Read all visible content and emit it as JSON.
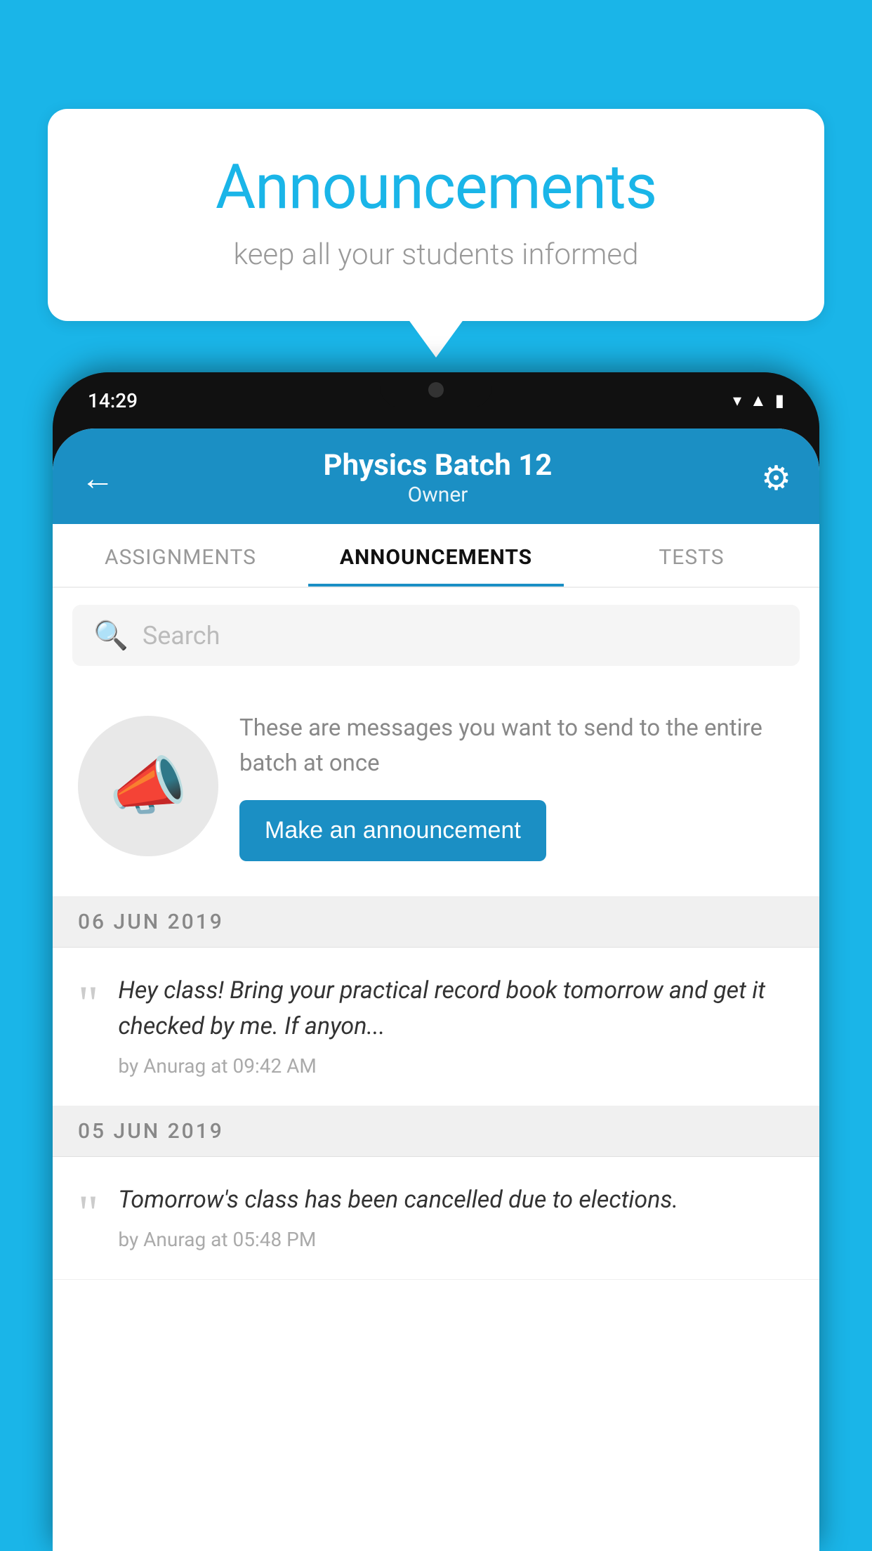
{
  "background_color": "#1ab5e8",
  "speech_bubble": {
    "title": "Announcements",
    "subtitle": "keep all your students informed"
  },
  "phone": {
    "status_bar": {
      "time": "14:29"
    },
    "header": {
      "title": "Physics Batch 12",
      "subtitle": "Owner",
      "back_label": "←",
      "settings_label": "⚙"
    },
    "tabs": [
      {
        "label": "ASSIGNMENTS",
        "active": false
      },
      {
        "label": "ANNOUNCEMENTS",
        "active": true
      },
      {
        "label": "TESTS",
        "active": false
      },
      {
        "label": "...",
        "active": false
      }
    ],
    "search": {
      "placeholder": "Search"
    },
    "promo": {
      "description": "These are messages you want to send to the entire batch at once",
      "button_label": "Make an announcement"
    },
    "announcements": [
      {
        "date": "06  JUN  2019",
        "body": "Hey class! Bring your practical record book tomorrow and get it checked by me. If anyon...",
        "meta": "by Anurag at 09:42 AM"
      },
      {
        "date": "05  JUN  2019",
        "body": "Tomorrow's class has been cancelled due to elections.",
        "meta": "by Anurag at 05:48 PM"
      }
    ]
  }
}
